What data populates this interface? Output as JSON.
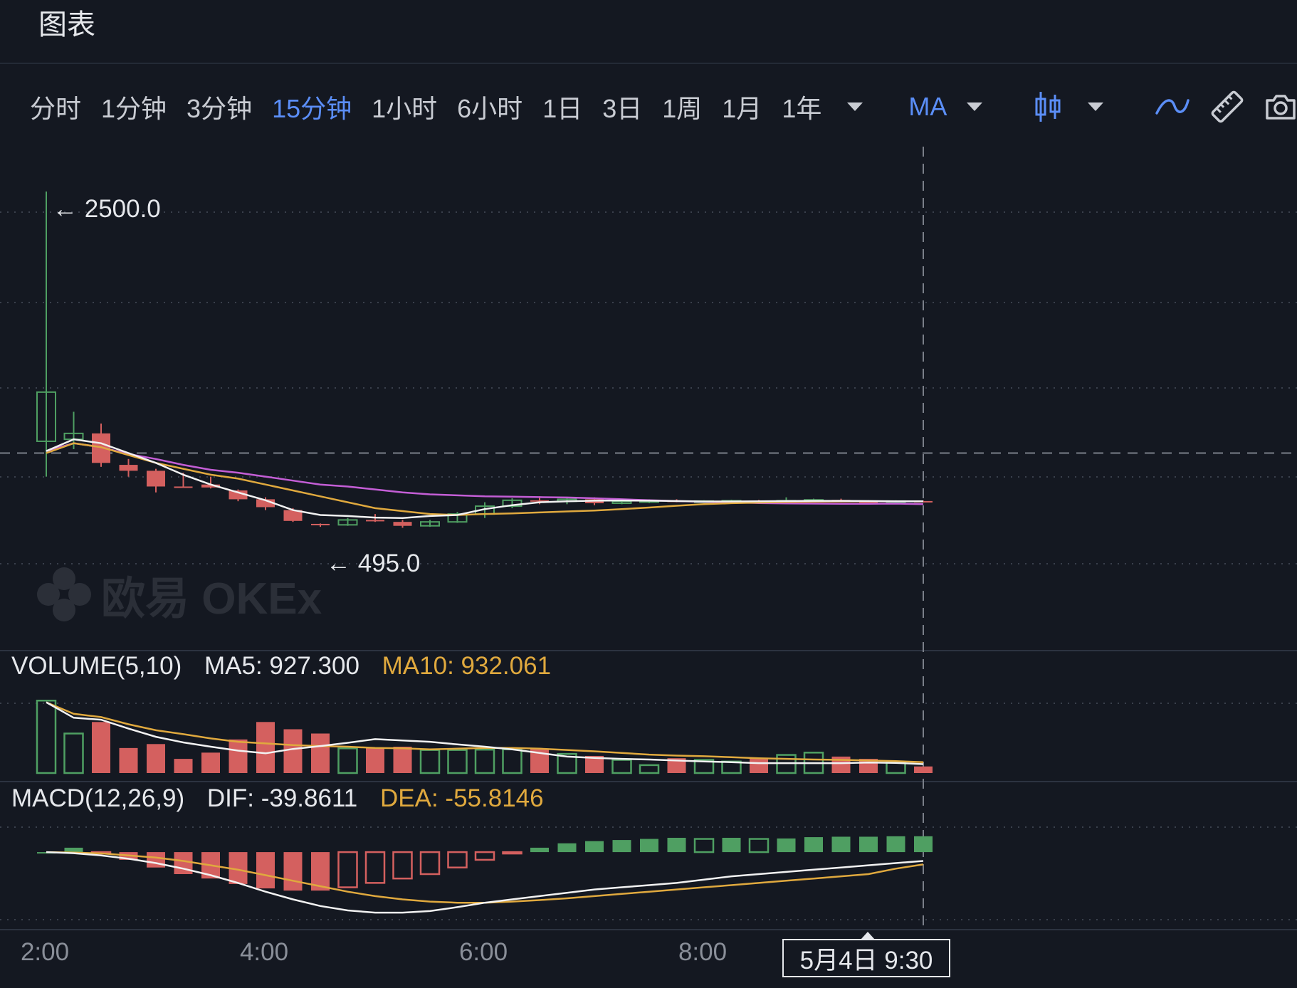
{
  "header": {
    "title": "图表"
  },
  "toolbar": {
    "timeframes": [
      "分时",
      "1分钟",
      "3分钟",
      "15分钟",
      "1小时",
      "6小时",
      "1日",
      "3日",
      "1周",
      "1月",
      "1年"
    ],
    "active_timeframe": "15分钟",
    "indicator": "MA",
    "icons": [
      "chevron-down-icon",
      "candlestick-icon",
      "line-draw-icon",
      "ruler-icon",
      "camera-icon"
    ]
  },
  "colors": {
    "up": "#4f9f62",
    "down": "#d4605f",
    "ma_white": "#f2f2f2",
    "ma_yellow": "#e0a93e",
    "ma_purple": "#c45ed6",
    "accent": "#5b8ef7",
    "background": "#141821"
  },
  "watermark": {
    "text": "欧易 OKEx"
  },
  "price_annotations": {
    "high": "← 2500.0",
    "low": "← 495.0"
  },
  "volume_legend": {
    "name": "VOLUME(5,10)",
    "ma5": "MA5: 927.300",
    "ma10": "MA10: 932.061"
  },
  "macd_legend": {
    "name": "MACD(12,26,9)",
    "dif": "DIF: -39.8611",
    "dea": "DEA: -55.8146"
  },
  "crosshair": {
    "label": "5月4日 9:30"
  },
  "chart_data": {
    "type": "candlestick",
    "x_ticks": [
      "2:00",
      "4:00",
      "6:00",
      "8:00"
    ],
    "price_axis_range": [
      180,
      2750
    ],
    "crosshair_price": 1170,
    "candles": [
      {
        "o": 1230,
        "h": 2500,
        "l": 1050,
        "c": 1480
      },
      {
        "o": 1240,
        "h": 1380,
        "l": 1190,
        "c": 1270
      },
      {
        "o": 1270,
        "h": 1320,
        "l": 1100,
        "c": 1120
      },
      {
        "o": 1110,
        "h": 1140,
        "l": 1050,
        "c": 1080
      },
      {
        "o": 1080,
        "h": 1090,
        "l": 970,
        "c": 1000
      },
      {
        "o": 1000,
        "h": 1070,
        "l": 995,
        "c": 998
      },
      {
        "o": 1010,
        "h": 1050,
        "l": 990,
        "c": 995
      },
      {
        "o": 980,
        "h": 985,
        "l": 925,
        "c": 935
      },
      {
        "o": 935,
        "h": 945,
        "l": 880,
        "c": 895
      },
      {
        "o": 880,
        "h": 890,
        "l": 820,
        "c": 825
      },
      {
        "o": 810,
        "h": 812,
        "l": 795,
        "c": 808
      },
      {
        "o": 805,
        "h": 840,
        "l": 800,
        "c": 830
      },
      {
        "o": 830,
        "h": 860,
        "l": 820,
        "c": 825
      },
      {
        "o": 820,
        "h": 830,
        "l": 790,
        "c": 800
      },
      {
        "o": 800,
        "h": 830,
        "l": 795,
        "c": 820
      },
      {
        "o": 820,
        "h": 870,
        "l": 815,
        "c": 860
      },
      {
        "o": 860,
        "h": 920,
        "l": 840,
        "c": 900
      },
      {
        "o": 900,
        "h": 940,
        "l": 890,
        "c": 930
      },
      {
        "o": 930,
        "h": 950,
        "l": 910,
        "c": 925
      },
      {
        "o": 925,
        "h": 940,
        "l": 910,
        "c": 935
      },
      {
        "o": 935,
        "h": 945,
        "l": 905,
        "c": 915
      },
      {
        "o": 915,
        "h": 935,
        "l": 910,
        "c": 925
      },
      {
        "o": 925,
        "h": 935,
        "l": 915,
        "c": 928
      },
      {
        "o": 928,
        "h": 935,
        "l": 920,
        "c": 925
      },
      {
        "o": 922,
        "h": 930,
        "l": 918,
        "c": 926
      },
      {
        "o": 926,
        "h": 933,
        "l": 920,
        "c": 928
      },
      {
        "o": 928,
        "h": 932,
        "l": 922,
        "c": 925
      },
      {
        "o": 925,
        "h": 945,
        "l": 920,
        "c": 928
      },
      {
        "o": 928,
        "h": 938,
        "l": 924,
        "c": 932
      },
      {
        "o": 932,
        "h": 938,
        "l": 920,
        "c": 924
      },
      {
        "o": 924,
        "h": 930,
        "l": 918,
        "c": 922
      },
      {
        "o": 922,
        "h": 930,
        "l": 918,
        "c": 926
      },
      {
        "o": 926,
        "h": 928,
        "l": 922,
        "c": 925
      }
    ],
    "ma_white": [
      1180,
      1240,
      1220,
      1170,
      1120,
      1060,
      1010,
      970,
      930,
      880,
      855,
      850,
      842,
      840,
      850,
      855,
      885,
      905,
      920,
      925,
      928,
      929,
      928,
      926,
      924,
      924,
      925,
      926,
      927,
      927,
      926,
      925,
      925
    ],
    "ma_yellow": [
      1170,
      1220,
      1200,
      1160,
      1120,
      1090,
      1060,
      1040,
      1010,
      980,
      950,
      920,
      890,
      875,
      860,
      855,
      860,
      863,
      868,
      873,
      878,
      885,
      893,
      902,
      910,
      915,
      918,
      921,
      923,
      924,
      925,
      925,
      925
    ],
    "ma_purple": [
      1180,
      1220,
      1200,
      1165,
      1140,
      1110,
      1085,
      1070,
      1050,
      1030,
      1010,
      1000,
      985,
      970,
      960,
      955,
      950,
      948,
      946,
      944,
      940,
      935,
      930,
      926,
      922,
      920,
      916,
      914,
      913,
      912,
      912,
      913,
      910
    ],
    "volume": {
      "values": [
        2200,
        1200,
        1550,
        760,
        880,
        430,
        620,
        1020,
        1550,
        1330,
        1200,
        750,
        760,
        800,
        700,
        700,
        710,
        720,
        730,
        580,
        520,
        400,
        240,
        450,
        400,
        350,
        450,
        550,
        620,
        500,
        430,
        320,
        200
      ],
      "ma5": [
        2150,
        1680,
        1620,
        1350,
        1100,
        930,
        800,
        680,
        600,
        730,
        820,
        920,
        1030,
        990,
        950,
        870,
        800,
        720,
        610,
        500,
        460,
        430,
        410,
        380,
        350,
        330,
        300,
        300,
        300,
        300,
        320,
        310,
        270
      ],
      "ma10": [
        2150,
        1800,
        1700,
        1480,
        1300,
        1180,
        1050,
        950,
        900,
        850,
        820,
        800,
        760,
        750,
        720,
        740,
        760,
        760,
        740,
        700,
        660,
        610,
        560,
        530,
        510,
        480,
        450,
        430,
        410,
        400,
        380,
        360,
        330
      ],
      "y_max": 2400
    },
    "macd": {
      "hist": [
        0,
        20,
        -5,
        -35,
        -70,
        -100,
        -120,
        -145,
        -165,
        -175,
        -175,
        -160,
        -140,
        -120,
        -100,
        -70,
        -35,
        -5,
        20,
        40,
        50,
        55,
        60,
        65,
        60,
        65,
        60,
        62,
        68,
        70,
        70,
        72,
        72
      ],
      "dif": [
        0,
        -5,
        -15,
        -30,
        -50,
        -75,
        -105,
        -140,
        -180,
        -215,
        -245,
        -265,
        -275,
        -275,
        -268,
        -250,
        -230,
        -215,
        -200,
        -185,
        -170,
        -160,
        -150,
        -140,
        -125,
        -110,
        -100,
        -90,
        -80,
        -70,
        -60,
        -50,
        -40
      ],
      "dea": [
        0,
        -2,
        -6,
        -15,
        -25,
        -40,
        -60,
        -80,
        -105,
        -130,
        -155,
        -180,
        -200,
        -215,
        -225,
        -230,
        -230,
        -225,
        -218,
        -210,
        -200,
        -190,
        -180,
        -170,
        -160,
        -150,
        -140,
        -130,
        -120,
        -110,
        -100,
        -75,
        -56
      ],
      "y_range": [
        -320,
        120
      ]
    }
  }
}
